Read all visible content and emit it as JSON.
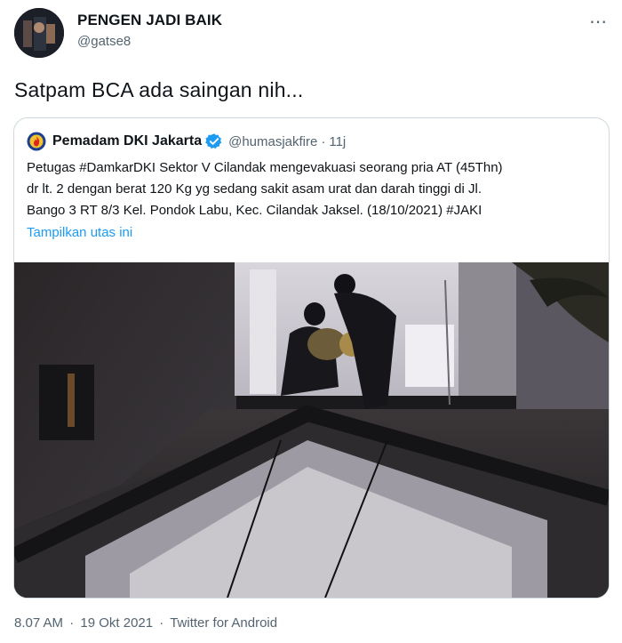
{
  "tweet": {
    "display_name": "PENGEN JADI BAIK",
    "handle": "@gatse8",
    "more_icon": "⋯",
    "text": "Satpam BCA ada saingan nih..."
  },
  "quote": {
    "account_name": "Pemadam DKI Jakarta",
    "handle": "@humasjakfire",
    "separator": "·",
    "time": "11j",
    "lines": [
      "Petugas #DamkarDKI Sektor V Cilandak mengevakuasi seorang pria AT (45Thn)",
      "dr lt. 2 dengan berat 120 Kg yg sedang sakit asam urat dan darah tinggi di Jl.",
      "Bango 3 RT 8/3 Kel. Pondok Labu, Kec. Cilandak Jaksel. (18/10/2021) #JAKI"
    ],
    "thread_link": "Tampilkan utas ini",
    "verified_icon": "verified-badge-icon",
    "logo_icon": "fire-department-logo-icon"
  },
  "footer": {
    "time": "8.07 AM",
    "sep1": "·",
    "date": "19 Okt 2021",
    "sep2": "·",
    "source": "Twitter for Android"
  },
  "colors": {
    "link": "#1d9bf0",
    "muted": "#536471",
    "border": "#cfd9de"
  }
}
